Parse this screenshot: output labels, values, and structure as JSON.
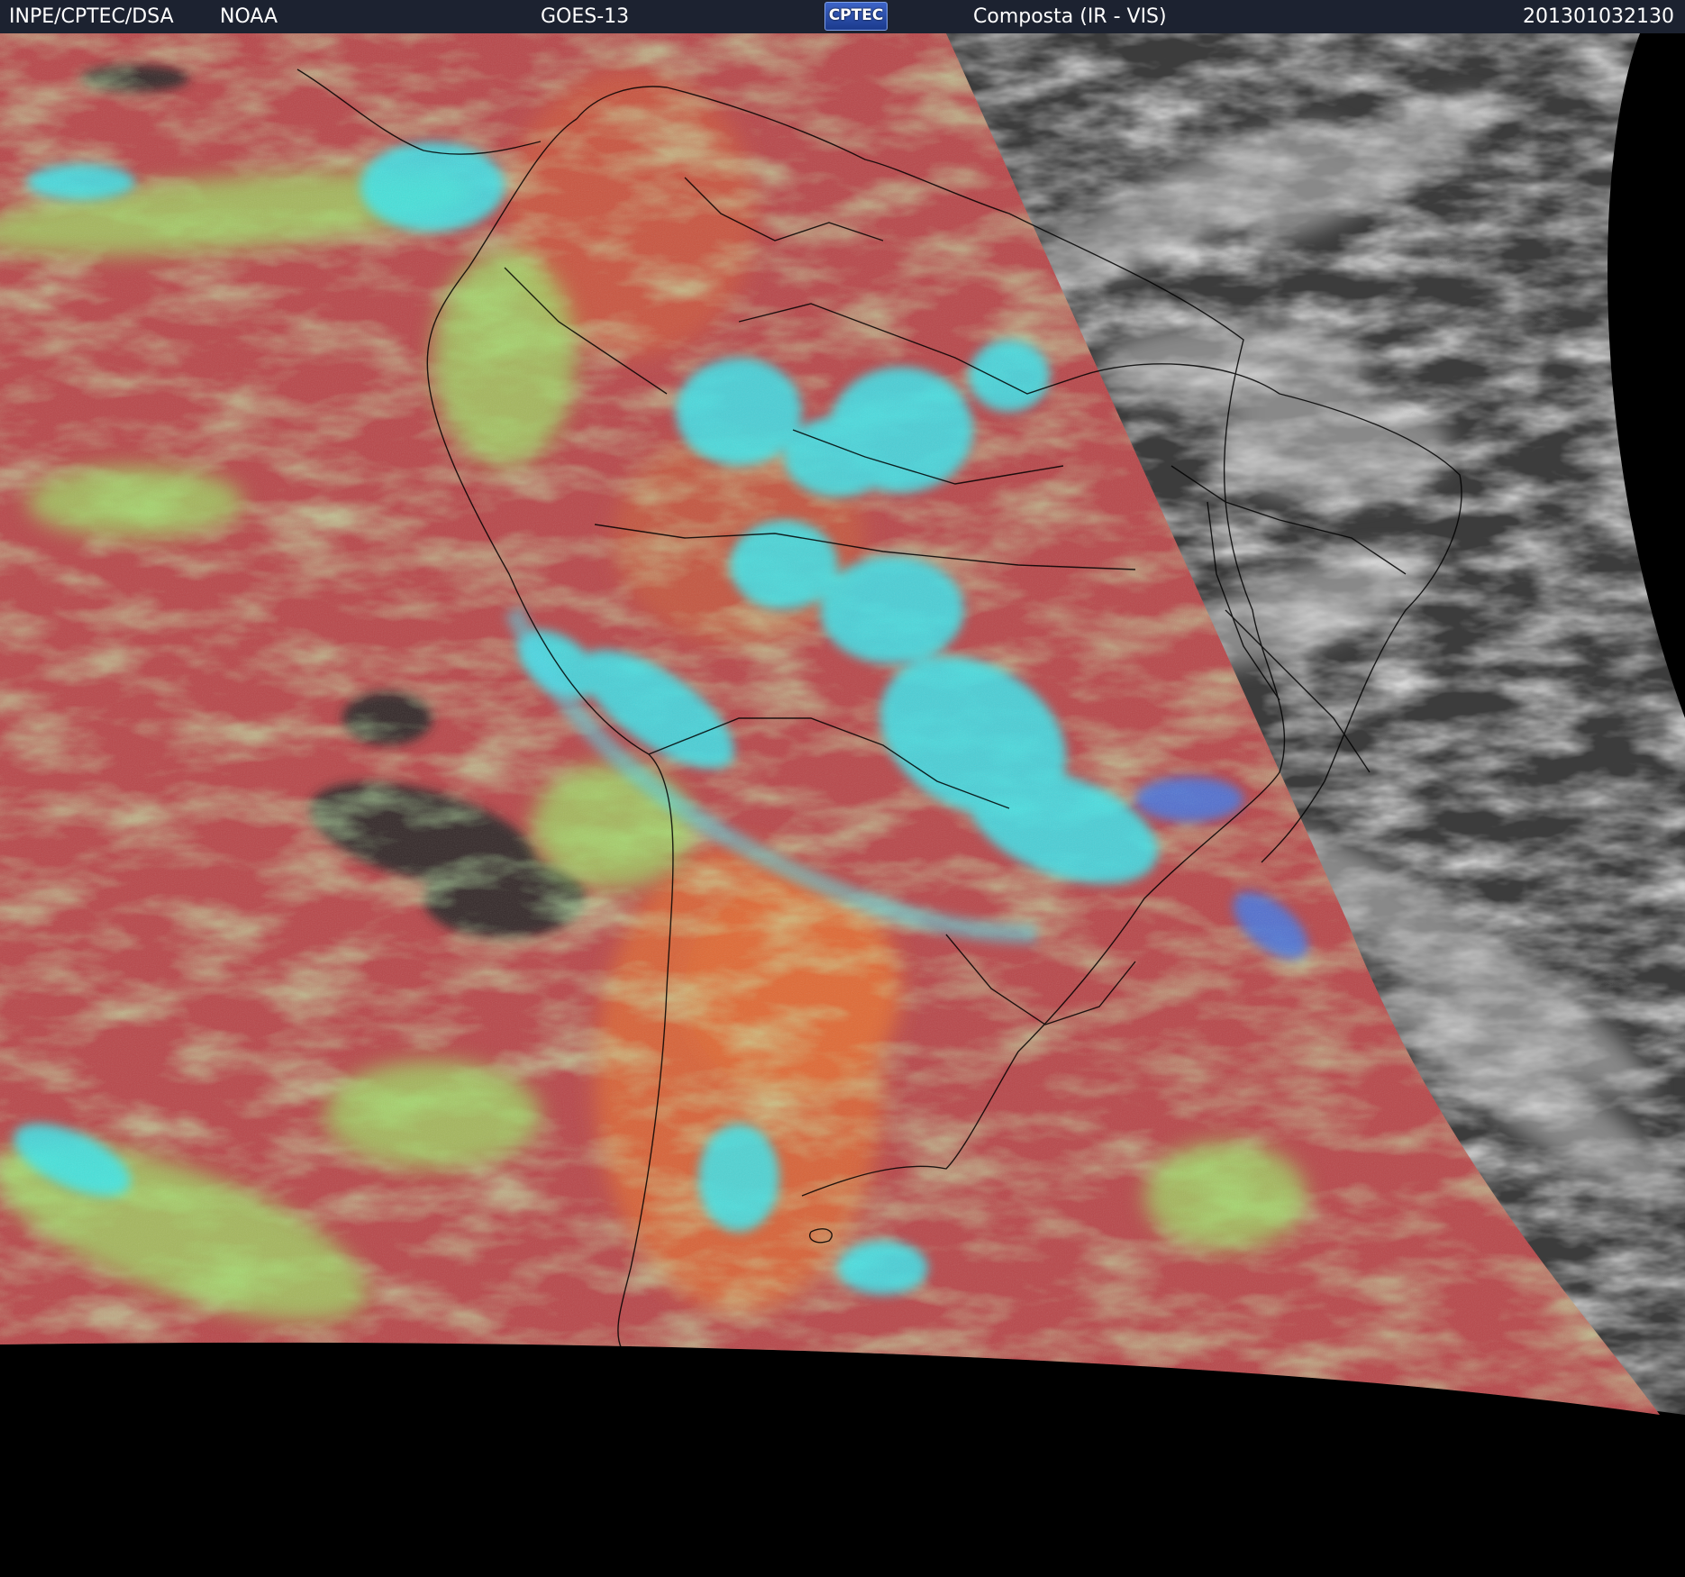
{
  "header": {
    "organization": "INPE/CPTEC/DSA",
    "agency": "NOAA",
    "satellite": "GOES-13",
    "logo_text": "CPTEC",
    "product": "Composta (IR - VIS)",
    "timestamp": "201301032130"
  },
  "colors": {
    "header_background": "#1c2230",
    "header_text": "#ffffff",
    "ocean_composite": "#b8474a",
    "warm_land_composite": "#d86438",
    "cold_cloud_cyan": "#38e8f0",
    "mid_cloud_green": "#9ce868",
    "visible_night_gray": "#3c3c3c",
    "off_disk_black": "#000000",
    "border_lines": "#000000"
  }
}
